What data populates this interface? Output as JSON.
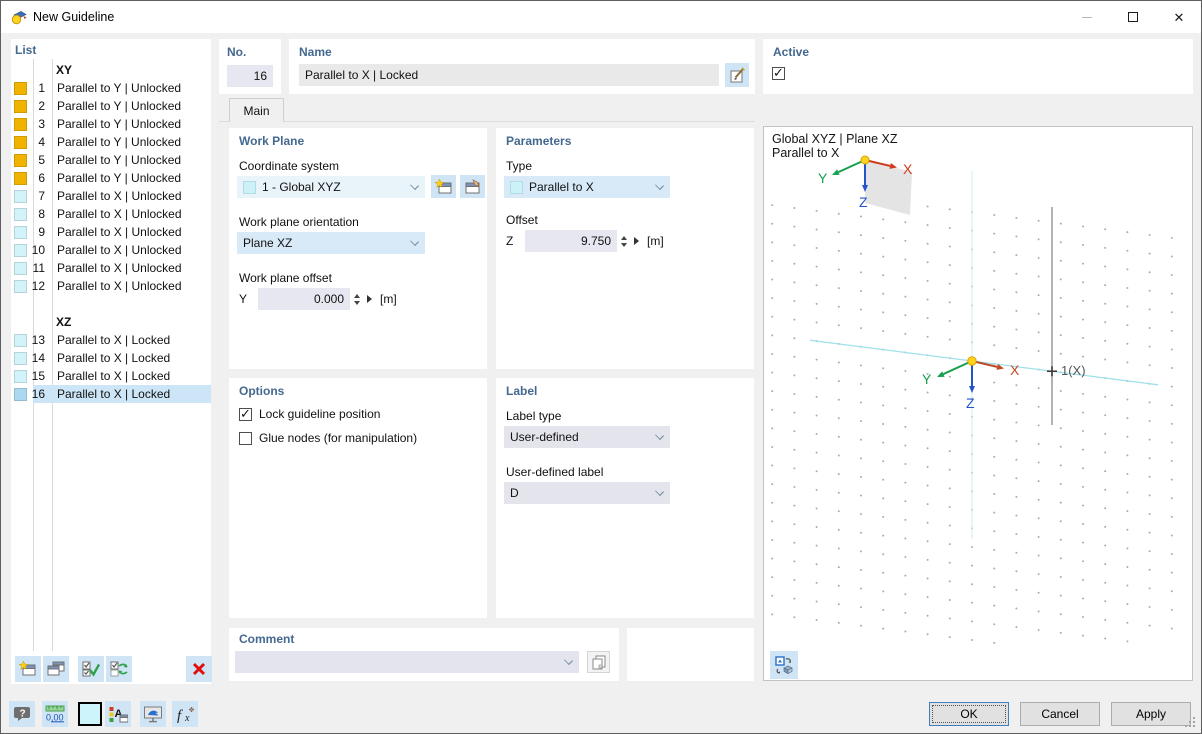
{
  "window": {
    "title": "New Guideline",
    "controls": {
      "minimize": "minimize",
      "maximize": "maximize",
      "close": "close"
    }
  },
  "list": {
    "title": "List",
    "groups": [
      {
        "name": "XY",
        "items": [
          {
            "no": "1",
            "label": "Parallel to Y | Unlocked",
            "color": "#f0b400"
          },
          {
            "no": "2",
            "label": "Parallel to Y | Unlocked",
            "color": "#f0b400"
          },
          {
            "no": "3",
            "label": "Parallel to Y | Unlocked",
            "color": "#f0b400"
          },
          {
            "no": "4",
            "label": "Parallel to Y | Unlocked",
            "color": "#f0b400"
          },
          {
            "no": "5",
            "label": "Parallel to Y | Unlocked",
            "color": "#f0b400"
          },
          {
            "no": "6",
            "label": "Parallel to Y | Unlocked",
            "color": "#f0b400"
          },
          {
            "no": "7",
            "label": "Parallel to X | Unlocked",
            "color": "#d2f3f9"
          },
          {
            "no": "8",
            "label": "Parallel to X | Unlocked",
            "color": "#d2f3f9"
          },
          {
            "no": "9",
            "label": "Parallel to X | Unlocked",
            "color": "#d2f3f9"
          },
          {
            "no": "10",
            "label": "Parallel to X | Unlocked",
            "color": "#d2f3f9"
          },
          {
            "no": "11",
            "label": "Parallel to X | Unlocked",
            "color": "#d2f3f9"
          },
          {
            "no": "12",
            "label": "Parallel to X | Unlocked",
            "color": "#d2f3f9"
          }
        ]
      },
      {
        "name": "XZ",
        "items": [
          {
            "no": "13",
            "label": "Parallel to X | Locked",
            "color": "#d2f3f9"
          },
          {
            "no": "14",
            "label": "Parallel to X | Locked",
            "color": "#d2f3f9"
          },
          {
            "no": "15",
            "label": "Parallel to X | Locked",
            "color": "#d2f3f9"
          },
          {
            "no": "16",
            "label": "Parallel to X | Locked",
            "color": "#a9d8f0",
            "selected": true
          }
        ]
      }
    ],
    "toolbar": [
      {
        "icon": "new-guideline-icon"
      },
      {
        "icon": "copy-guideline-icon"
      },
      {
        "icon": "select-all-icon"
      },
      {
        "icon": "invert-selection-icon"
      },
      {
        "icon": "delete-x-icon"
      }
    ]
  },
  "header": {
    "no_label": "No.",
    "no_value": "16",
    "name_label": "Name",
    "name_value": "Parallel to X | Locked",
    "active_label": "Active",
    "active_checked": true
  },
  "tab": {
    "label": "Main"
  },
  "work_plane": {
    "title": "Work Plane",
    "coordinate_system_label": "Coordinate system",
    "coordinate_system_value": "1 - Global XYZ",
    "orientation_label": "Work plane orientation",
    "orientation_value": "Plane XZ",
    "offset_label": "Work plane offset",
    "offset_axis": "Y",
    "offset_value": "0.000",
    "offset_unit": "[m]"
  },
  "parameters": {
    "title": "Parameters",
    "type_label": "Type",
    "type_value": "Parallel to X",
    "offset_label": "Offset",
    "offset_axis": "Z",
    "offset_value": "9.750",
    "offset_unit": "[m]"
  },
  "options": {
    "title": "Options",
    "checkboxes": [
      {
        "label": "Lock guideline position",
        "checked": true
      },
      {
        "label": "Glue nodes (for manipulation)",
        "checked": false
      }
    ]
  },
  "label_section": {
    "title": "Label",
    "type_label": "Label type",
    "type_value": "User-defined",
    "user_label": "User-defined label",
    "user_value": "D"
  },
  "comment": {
    "title": "Comment",
    "value": ""
  },
  "preview": {
    "header_line1": "Global XYZ | Plane XZ",
    "header_line2": "Parallel to X",
    "axes": {
      "x": "X",
      "y": "Y",
      "z": "Z"
    },
    "marker_label": "1(X)"
  },
  "footer": {
    "tools": [
      {
        "icon": "help-icon"
      },
      {
        "icon": "units-icon"
      },
      {
        "icon": "guideline-color-swatch"
      },
      {
        "icon": "display-properties-icon"
      },
      {
        "icon": "monitor-config-icon"
      },
      {
        "icon": "formula-icon"
      }
    ],
    "ok": "OK",
    "cancel": "Cancel",
    "apply": "Apply"
  },
  "colors": {
    "accent_button": "#cfe4f4",
    "selection": "#cde6f7",
    "swatch_yellow": "#f0b400",
    "swatch_cyan": "#d2f3f9",
    "swatch_selected": "#a9d8f0",
    "guideline_cyan": "#a0e0ec",
    "axis_x": "#bf4a2a",
    "axis_y": "#17a04d",
    "axis_z": "#2553cc",
    "origin_dot": "#ffd21e"
  }
}
